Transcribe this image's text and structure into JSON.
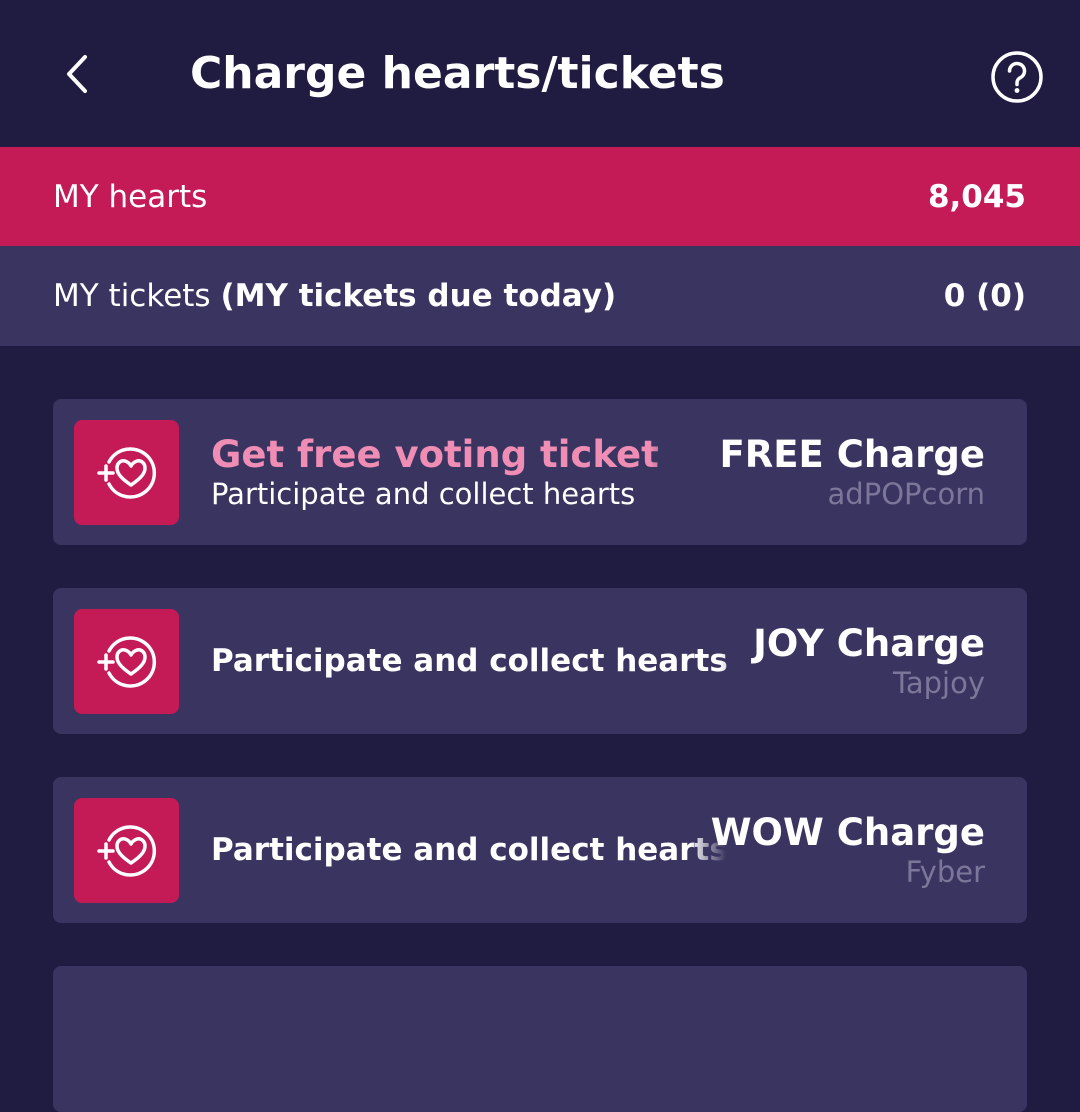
{
  "header": {
    "title": "Charge hearts/tickets"
  },
  "hearts": {
    "label": "MY hearts",
    "value": "8,045"
  },
  "tickets": {
    "label": "MY tickets",
    "label_bold": "(MY tickets due today)",
    "value": "0 (0)"
  },
  "cards": [
    {
      "promo": "Get free voting ticket",
      "description": "Participate and collect hearts",
      "name": "FREE Charge",
      "provider": "adPOPcorn"
    },
    {
      "description": "Participate and collect hearts",
      "name": "JOY Charge",
      "provider": "Tapjoy"
    },
    {
      "description": "Participate and collect hearts",
      "name": "WOW Charge",
      "provider": "Fyber"
    }
  ],
  "colors": {
    "background": "#201b40",
    "accent": "#c41a55",
    "card": "#3a3460",
    "promo_text": "#ef8db5",
    "provider_text": "#7c779a"
  },
  "icons": {
    "back": "chevron-left-icon",
    "help": "help-circle-icon",
    "charge": "add-heart-icon"
  }
}
